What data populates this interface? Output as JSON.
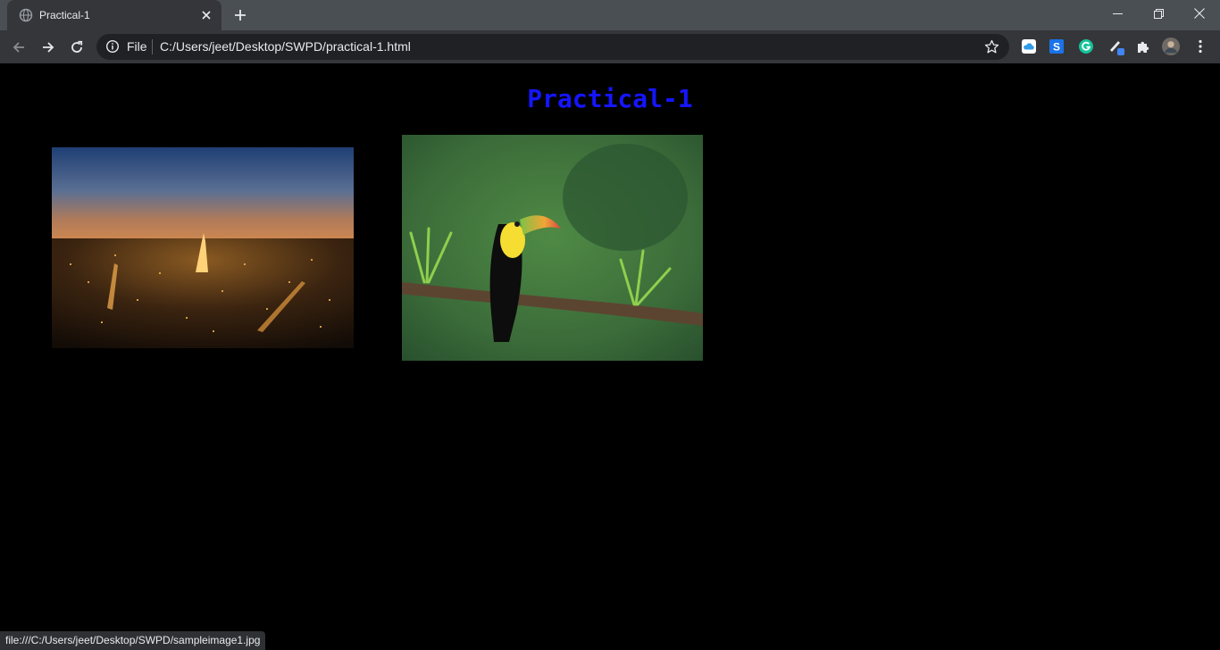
{
  "tab": {
    "title": "Practical-1"
  },
  "omnibox": {
    "scheme_chip": "File",
    "url": "C:/Users/jeet/Desktop/SWPD/practical-1.html"
  },
  "extensions": [
    "cloud-icon",
    "s-extension-icon",
    "grammarly-icon",
    "pen-extension-icon",
    "puzzle-icon",
    "avatar",
    "kebab-menu-icon"
  ],
  "page": {
    "heading": "Practical-1",
    "heading_color": "#1515ff",
    "background": "#000000",
    "images": [
      {
        "name": "paris-night-image",
        "subject": "Paris skyline at night with Eiffel Tower"
      },
      {
        "name": "toucan-image",
        "subject": "Toucan on a mossy branch in rain"
      }
    ]
  },
  "status_bar": {
    "text": "file:///C:/Users/jeet/Desktop/SWPD/sampleimage1.jpg"
  },
  "colors": {
    "tabstrip": "#4a4f54",
    "toolbar": "#35363a",
    "omnibox": "#202124",
    "text": "#e8eaed"
  }
}
